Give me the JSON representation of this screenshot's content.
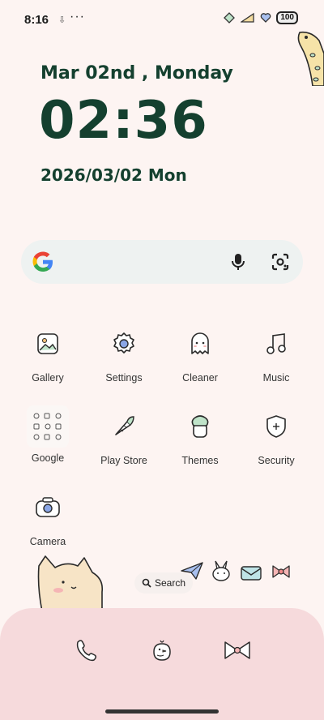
{
  "status_bar": {
    "time": "8:16",
    "more": "···",
    "battery": "100"
  },
  "widget": {
    "date_line": "Mar 02nd , Monday",
    "clock": "02:36",
    "date_full": "2026/03/02 Mon"
  },
  "apps": [
    {
      "label": "Gallery",
      "icon": "gallery-icon"
    },
    {
      "label": "Settings",
      "icon": "gear-icon"
    },
    {
      "label": "Cleaner",
      "icon": "ghost-icon"
    },
    {
      "label": "Music",
      "icon": "music-note-icon"
    },
    {
      "label": "Google",
      "icon": "google-folder-icon"
    },
    {
      "label": "Play Store",
      "icon": "carrot-icon"
    },
    {
      "label": "Themes",
      "icon": "themes-icon"
    },
    {
      "label": "Security",
      "icon": "shield-icon"
    },
    {
      "label": "Camera",
      "icon": "camera-icon"
    }
  ],
  "search_pill": {
    "label": "Search"
  },
  "dock": [
    "phone-icon",
    "chick-icon",
    "bow-icon"
  ],
  "colors": {
    "background": "#fdf4f2",
    "text_dark_green": "#14402f",
    "dock": "#f6dadc",
    "accent_blue": "#8aa6e6",
    "accent_green": "#bfe3c9"
  }
}
